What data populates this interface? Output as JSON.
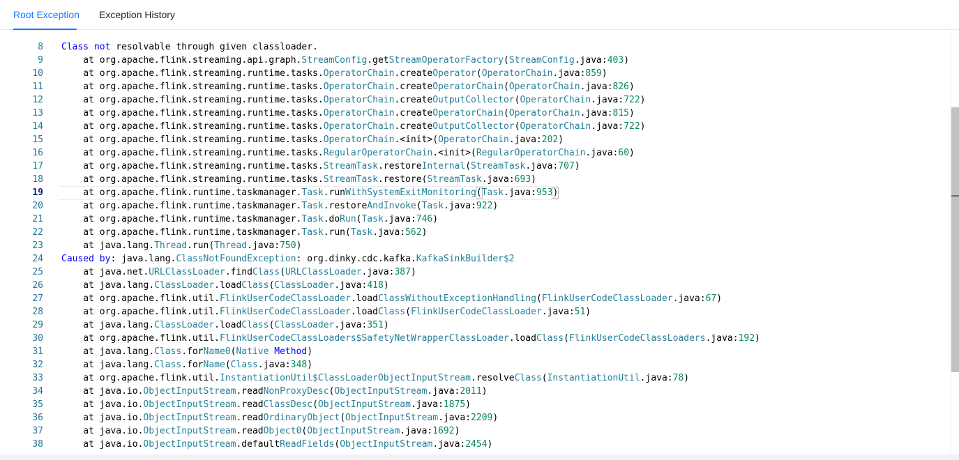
{
  "tabs": [
    {
      "label": "Root Exception",
      "active": true
    },
    {
      "label": "Exception History",
      "active": false
    }
  ],
  "colors": {
    "accent": "#1677ff",
    "line_number": "#237893",
    "class_token": "#267f99",
    "number_token": "#098658",
    "keyword_token": "#0000ff"
  },
  "editor": {
    "current_line": 19,
    "lines": [
      {
        "n": "8",
        "text": "Class not resolvable through given classloader."
      },
      {
        "n": "9",
        "text": "    at org.apache.flink.streaming.api.graph.StreamConfig.getStreamOperatorFactory(StreamConfig.java:403)"
      },
      {
        "n": "10",
        "text": "    at org.apache.flink.streaming.runtime.tasks.OperatorChain.createOperator(OperatorChain.java:859)"
      },
      {
        "n": "11",
        "text": "    at org.apache.flink.streaming.runtime.tasks.OperatorChain.createOperatorChain(OperatorChain.java:826)"
      },
      {
        "n": "12",
        "text": "    at org.apache.flink.streaming.runtime.tasks.OperatorChain.createOutputCollector(OperatorChain.java:722)"
      },
      {
        "n": "13",
        "text": "    at org.apache.flink.streaming.runtime.tasks.OperatorChain.createOperatorChain(OperatorChain.java:815)"
      },
      {
        "n": "14",
        "text": "    at org.apache.flink.streaming.runtime.tasks.OperatorChain.createOutputCollector(OperatorChain.java:722)"
      },
      {
        "n": "15",
        "text": "    at org.apache.flink.streaming.runtime.tasks.OperatorChain.<init>(OperatorChain.java:202)"
      },
      {
        "n": "16",
        "text": "    at org.apache.flink.streaming.runtime.tasks.RegularOperatorChain.<init>(RegularOperatorChain.java:60)"
      },
      {
        "n": "17",
        "text": "    at org.apache.flink.streaming.runtime.tasks.StreamTask.restoreInternal(StreamTask.java:707)"
      },
      {
        "n": "18",
        "text": "    at org.apache.flink.streaming.runtime.tasks.StreamTask.restore(StreamTask.java:693)"
      },
      {
        "n": "19",
        "text": "    at org.apache.flink.runtime.taskmanager.Task.runWithSystemExitMonitoring(Task.java:953)"
      },
      {
        "n": "20",
        "text": "    at org.apache.flink.runtime.taskmanager.Task.restoreAndInvoke(Task.java:922)"
      },
      {
        "n": "21",
        "text": "    at org.apache.flink.runtime.taskmanager.Task.doRun(Task.java:746)"
      },
      {
        "n": "22",
        "text": "    at org.apache.flink.runtime.taskmanager.Task.run(Task.java:562)"
      },
      {
        "n": "23",
        "text": "    at java.lang.Thread.run(Thread.java:750)"
      },
      {
        "n": "24",
        "text": "Caused by: java.lang.ClassNotFoundException: org.dinky.cdc.kafka.KafkaSinkBuilder$2"
      },
      {
        "n": "25",
        "text": "    at java.net.URLClassLoader.findClass(URLClassLoader.java:387)"
      },
      {
        "n": "26",
        "text": "    at java.lang.ClassLoader.loadClass(ClassLoader.java:418)"
      },
      {
        "n": "27",
        "text": "    at org.apache.flink.util.FlinkUserCodeClassLoader.loadClassWithoutExceptionHandling(FlinkUserCodeClassLoader.java:67)"
      },
      {
        "n": "28",
        "text": "    at org.apache.flink.util.FlinkUserCodeClassLoader.loadClass(FlinkUserCodeClassLoader.java:51)"
      },
      {
        "n": "29",
        "text": "    at java.lang.ClassLoader.loadClass(ClassLoader.java:351)"
      },
      {
        "n": "30",
        "text": "    at org.apache.flink.util.FlinkUserCodeClassLoaders$SafetyNetWrapperClassLoader.loadClass(FlinkUserCodeClassLoaders.java:192)"
      },
      {
        "n": "31",
        "text": "    at java.lang.Class.forName0(Native Method)"
      },
      {
        "n": "32",
        "text": "    at java.lang.Class.forName(Class.java:348)"
      },
      {
        "n": "33",
        "text": "    at org.apache.flink.util.InstantiationUtil$ClassLoaderObjectInputStream.resolveClass(InstantiationUtil.java:78)"
      },
      {
        "n": "34",
        "text": "    at java.io.ObjectInputStream.readNonProxyDesc(ObjectInputStream.java:2011)"
      },
      {
        "n": "35",
        "text": "    at java.io.ObjectInputStream.readClassDesc(ObjectInputStream.java:1875)"
      },
      {
        "n": "36",
        "text": "    at java.io.ObjectInputStream.readOrdinaryObject(ObjectInputStream.java:2209)"
      },
      {
        "n": "37",
        "text": "    at java.io.ObjectInputStream.readObject0(ObjectInputStream.java:1692)"
      },
      {
        "n": "38",
        "text": "    at java.io.ObjectInputStream.defaultReadFields(ObjectInputStream.java:2454)"
      }
    ]
  }
}
